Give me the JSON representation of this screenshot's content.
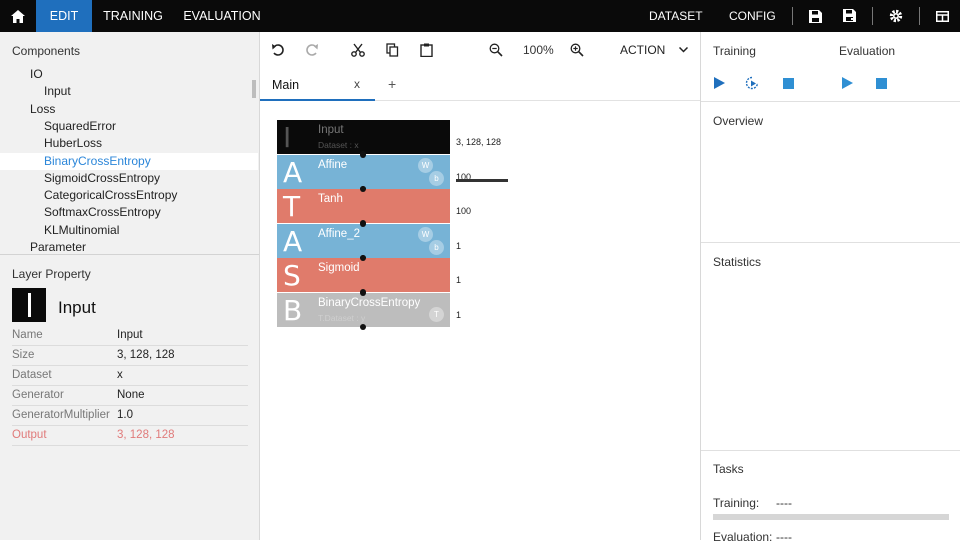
{
  "topbar": {
    "tabs": [
      "EDIT",
      "TRAINING",
      "EVALUATION"
    ],
    "right_tabs": [
      "DATASET",
      "CONFIG"
    ],
    "accent": "#1f6fbd"
  },
  "left": {
    "components_title": "Components",
    "tree": [
      {
        "label": "IO",
        "indent": 1
      },
      {
        "label": "Input",
        "indent": 2
      },
      {
        "label": "Loss",
        "indent": 1
      },
      {
        "label": "SquaredError",
        "indent": 2
      },
      {
        "label": "HuberLoss",
        "indent": 2
      },
      {
        "label": "BinaryCrossEntropy",
        "indent": 2,
        "selected": true
      },
      {
        "label": "SigmoidCrossEntropy",
        "indent": 2
      },
      {
        "label": "CategoricalCrossEntropy",
        "indent": 2
      },
      {
        "label": "SoftmaxCrossEntropy",
        "indent": 2
      },
      {
        "label": "KLMultinomial",
        "indent": 2
      },
      {
        "label": "Parameter",
        "indent": 1
      }
    ],
    "layer_property_title": "Layer Property",
    "layer_name": "Input",
    "properties": [
      {
        "key": "Name",
        "value": "Input"
      },
      {
        "key": "Size",
        "value": "3, 128, 128"
      },
      {
        "key": "Dataset",
        "value": "x"
      },
      {
        "key": "Generator",
        "value": "None"
      },
      {
        "key": "GeneratorMultiplier",
        "value": "1.0"
      },
      {
        "key": "Output",
        "value": "3, 128, 128",
        "highlight": true
      }
    ]
  },
  "center": {
    "zoom": "100%",
    "action": "ACTION",
    "tab_main": "Main",
    "tab_close": "x",
    "tab_add": "+",
    "layers": [
      {
        "glyph": "I",
        "name": "Input",
        "sub": "Dataset : x",
        "color": "#0a0a0a",
        "badges": [],
        "shape": "3, 128, 128"
      },
      {
        "glyph": "A",
        "name": "Affine",
        "sub": "",
        "color": "#77b3d6",
        "badges": [
          "W",
          "b"
        ],
        "shape": "100"
      },
      {
        "glyph": "T",
        "name": "Tanh",
        "sub": "",
        "color": "#e07b6b",
        "badges": [],
        "shape": "100"
      },
      {
        "glyph": "A",
        "name": "Affine_2",
        "sub": "",
        "color": "#77b3d6",
        "badges": [
          "W",
          "b"
        ],
        "shape": "1"
      },
      {
        "glyph": "S",
        "name": "Sigmoid",
        "sub": "",
        "color": "#e07b6b",
        "badges": [],
        "shape": "1"
      },
      {
        "glyph": "B",
        "name": "BinaryCrossEntropy",
        "sub": "T.Dataset : y",
        "color": "#bdbdbd",
        "badges": [
          "T"
        ],
        "shape": "1"
      }
    ]
  },
  "right": {
    "training": "Training",
    "evaluation": "Evaluation",
    "overview": "Overview",
    "statistics": "Statistics",
    "tasks": "Tasks",
    "training_label": "Training:",
    "training_value": "----",
    "evaluation_label": "Evaluation:",
    "evaluation_value": "----",
    "icon_color": "#1f6fbd"
  }
}
